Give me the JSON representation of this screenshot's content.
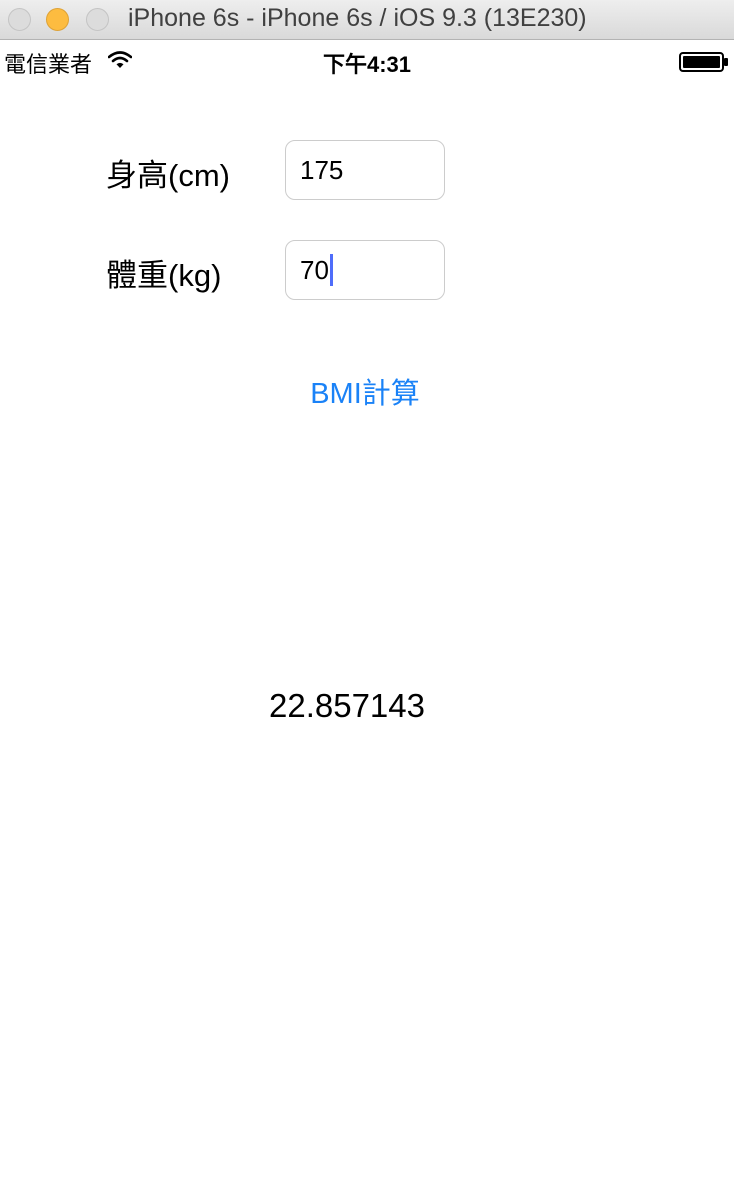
{
  "window": {
    "title": "iPhone 6s - iPhone 6s / iOS 9.3 (13E230)",
    "traffic_colors": {
      "close": "#dcdcdc",
      "minimize": "#fdbc40",
      "zoom": "#dcdcdc"
    }
  },
  "status_bar": {
    "carrier": "電信業者",
    "time": "下午4:31",
    "icons": [
      "wifi-icon",
      "battery-icon"
    ]
  },
  "form": {
    "height_label": "身高(cm)",
    "height_value": "175",
    "weight_label": "體重(kg)",
    "weight_value": "70"
  },
  "action": {
    "button_label": "BMI計算",
    "accent_color": "#1a82f7"
  },
  "result": {
    "bmi_value": "22.857143"
  }
}
